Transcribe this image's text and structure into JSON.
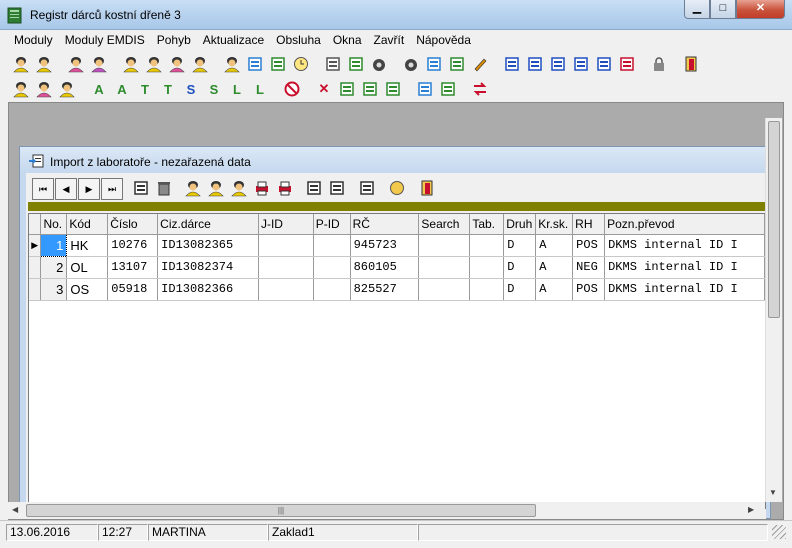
{
  "window": {
    "title": "Registr dárců kostní dřeně 3",
    "min_glyph": "▁",
    "max_glyph": "□",
    "close_glyph": "✕"
  },
  "menu": [
    "Moduly",
    "Moduly EMDIS",
    "Pohyb",
    "Aktualizace",
    "Obsluha",
    "Okna",
    "Zavřít",
    "Nápověda"
  ],
  "toolbar1": [
    {
      "icon": "person-yellow-icon",
      "color": "#e8c800"
    },
    {
      "icon": "person-yellow-icon",
      "color": "#e8c800"
    },
    {
      "icon": "person-pink-icon",
      "color": "#e0509a"
    },
    {
      "icon": "person-purple-icon",
      "color": "#c050c0"
    },
    {
      "icon": "person-yellow-icon",
      "color": "#e8c800"
    },
    {
      "icon": "person-yellow-icon",
      "color": "#e8c800"
    },
    {
      "icon": "person-pink-icon",
      "color": "#e0509a"
    },
    {
      "icon": "person-yellow-icon",
      "color": "#e8c800"
    },
    {
      "icon": "person-yellow-icon",
      "color": "#e8c800"
    },
    {
      "icon": "document-import-icon",
      "color": "#2a7fd4"
    },
    {
      "icon": "spreadsheet-icon",
      "color": "#2e8b2e"
    },
    {
      "icon": "clock-icon",
      "color": "#d8b000"
    },
    {
      "icon": "calculator-icon",
      "color": "#555555"
    },
    {
      "icon": "grid-table-icon",
      "color": "#2e8b2e"
    },
    {
      "icon": "telephone-icon",
      "color": "#333333"
    },
    {
      "icon": "telephone-icon",
      "color": "#333333"
    },
    {
      "icon": "document-list-icon",
      "color": "#2a7fd4"
    },
    {
      "icon": "document-arrow-icon",
      "color": "#2e8b2e"
    },
    {
      "icon": "pen-icon",
      "color": "#d88a00"
    },
    {
      "icon": "columns-icon",
      "color": "#1f4fbf"
    },
    {
      "icon": "rows-icon",
      "color": "#1f4fbf"
    },
    {
      "icon": "cascade-windows-icon",
      "color": "#1f4fbf"
    },
    {
      "icon": "minimize-windows-icon",
      "color": "#1f4fbf"
    },
    {
      "icon": "arrange-icons-icon",
      "color": "#1f4fbf"
    },
    {
      "icon": "flag-icon",
      "color": "#c8102e"
    },
    {
      "icon": "lock-icon",
      "color": "#666666"
    },
    {
      "icon": "exit-door-icon",
      "color": "#c8102e"
    }
  ],
  "toolbar2": [
    {
      "icon": "person-yellow-icon",
      "color": "#e8c800"
    },
    {
      "icon": "person-pink-icon",
      "color": "#e0509a"
    },
    {
      "icon": "person-yellow-icon",
      "color": "#e8c800"
    },
    {
      "icon": "letter-a-icon",
      "color": "#2e8b2e",
      "glyph": "A"
    },
    {
      "icon": "letter-a-icon",
      "color": "#2e8b2e",
      "glyph": "A"
    },
    {
      "icon": "letter-t-icon",
      "color": "#2e8b2e",
      "glyph": "T"
    },
    {
      "icon": "letter-t-icon",
      "color": "#2e8b2e",
      "glyph": "T"
    },
    {
      "icon": "letter-s-icon",
      "color": "#1f4fbf",
      "glyph": "S"
    },
    {
      "icon": "letter-s-icon",
      "color": "#2e8b2e",
      "glyph": "S"
    },
    {
      "icon": "letter-l-icon",
      "color": "#2e8b2e",
      "glyph": "L"
    },
    {
      "icon": "letter-l-icon",
      "color": "#2e8b2e",
      "glyph": "L"
    },
    {
      "icon": "no-entry-icon",
      "color": "#c8102e"
    },
    {
      "icon": "cross-icon",
      "color": "#c8102e",
      "glyph": "✕"
    },
    {
      "icon": "filter-icon",
      "color": "#2e8b2e"
    },
    {
      "icon": "search-icon",
      "color": "#2e8b2e"
    },
    {
      "icon": "check-search-icon",
      "color": "#2e8b2e"
    },
    {
      "icon": "document-list-icon",
      "color": "#2a7fd4"
    },
    {
      "icon": "notebook-icon",
      "color": "#2e8b2e"
    },
    {
      "icon": "swap-arrows-icon",
      "color": "#c8102e"
    }
  ],
  "child": {
    "title": "Import z laboratoře - nezařazená data",
    "nav": [
      {
        "icon": "first-record-icon",
        "glyph": "⏮"
      },
      {
        "icon": "previous-record-icon",
        "glyph": "◀"
      },
      {
        "icon": "next-record-icon",
        "glyph": "▶"
      },
      {
        "icon": "last-record-icon",
        "glyph": "⏭"
      },
      {
        "icon": "list-icon"
      },
      {
        "icon": "trash-icon"
      },
      {
        "icon": "person-yellow-icon"
      },
      {
        "icon": "person-yellow-icon"
      },
      {
        "icon": "person-yellow-icon"
      },
      {
        "icon": "print-icon"
      },
      {
        "icon": "print-preview-icon"
      },
      {
        "icon": "document-import-icon"
      },
      {
        "icon": "document-import-icon"
      },
      {
        "icon": "document-icon"
      },
      {
        "icon": "help-icon"
      },
      {
        "icon": "exit-door-icon"
      }
    ],
    "columns": [
      "No.",
      "Kód",
      "Číslo",
      "Ciz.dárce",
      "J-ID",
      "P-ID",
      "RČ",
      "Search",
      "Tab.",
      "Druh",
      "Kr.sk.",
      "RH",
      "Pozn.převod"
    ],
    "rows": [
      [
        "1",
        "HK",
        "10276",
        "ID13082365",
        "",
        "",
        "945723",
        "",
        "",
        "D",
        "A",
        "POS",
        "DKMS internal ID I"
      ],
      [
        "2",
        "OL",
        "13107",
        "ID13082374",
        "",
        "",
        "860105",
        "",
        "",
        "D",
        "A",
        "NEG",
        "DKMS internal ID I"
      ],
      [
        "3",
        "OS",
        "05918",
        "ID13082366",
        "",
        "",
        "825527",
        "",
        "",
        "D",
        "A",
        "POS",
        "DKMS internal ID I"
      ]
    ],
    "current_row_marker": "▶",
    "hscroll_grip": "|||"
  },
  "status": {
    "date": "13.06.2016",
    "time": "12:27",
    "user": "MARTINA",
    "db": "Zaklad1",
    "extra": ""
  },
  "colors": {
    "olive_bar": "#808000",
    "selection": "#3399ff",
    "titlebar": "#b7d2ee"
  }
}
